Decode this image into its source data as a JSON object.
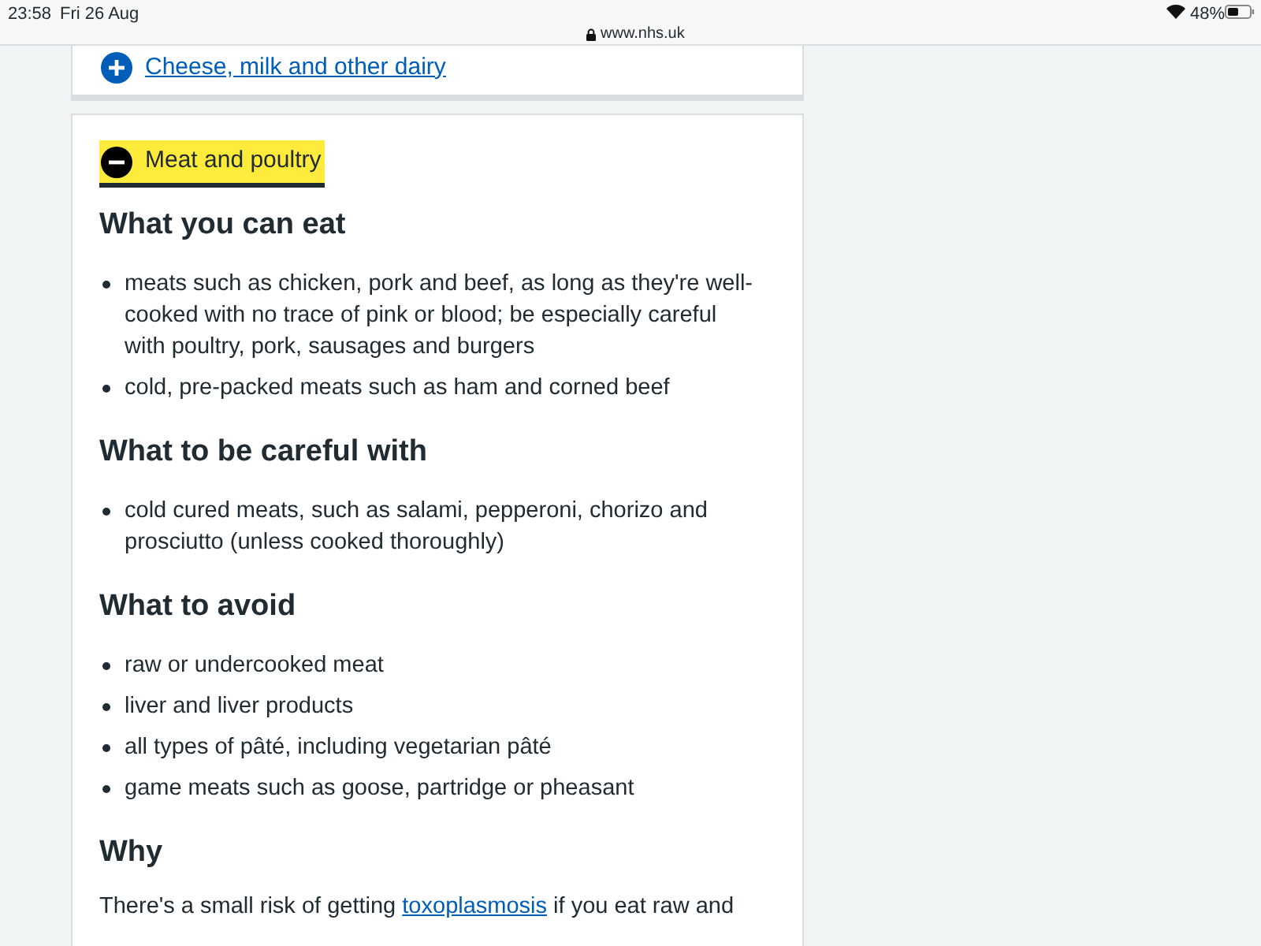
{
  "status_bar": {
    "time": "23:58",
    "date": "Fri 26 Aug",
    "url": "www.nhs.uk",
    "battery": "48%"
  },
  "sections": [
    {
      "label": "Cheese, milk and other dairy",
      "expanded": false
    },
    {
      "label": "Meat and poultry",
      "expanded": true,
      "subsections": [
        {
          "heading": "What you can eat",
          "items": [
            "meats such as chicken, pork and beef, as long as they're well-cooked with no trace of pink or blood; be especially careful with poultry, pork, sausages and burgers",
            "cold, pre-packed meats such as ham and corned beef"
          ]
        },
        {
          "heading": "What to be careful with",
          "items": [
            "cold cured meats, such as salami, pepperoni, chorizo and prosciutto (unless cooked thoroughly)"
          ]
        },
        {
          "heading": "What to avoid",
          "items": [
            "raw or undercooked meat",
            "liver and liver products",
            "all types of pâté, including vegetarian pâté",
            "game meats such as goose, partridge or pheasant"
          ]
        },
        {
          "heading": "Why",
          "paragraph": {
            "before": "There's a small risk of getting ",
            "link": "toxoplasmosis",
            "after": " if you eat raw and"
          }
        }
      ]
    }
  ]
}
